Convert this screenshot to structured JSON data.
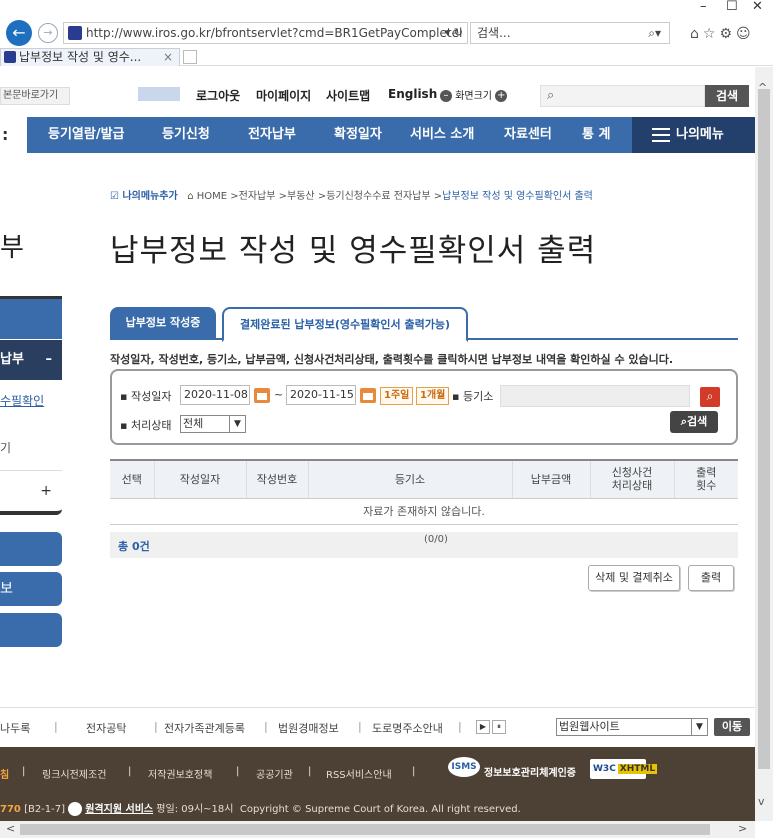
{
  "browser": {
    "address_url": "http://www.iros.go.kr/bfrontservlet?cmd=BR1GetPayCompletel",
    "address_controls": "▾ ↻",
    "search_placeholder": "검색...",
    "tab_title": "납부정보 작성 및 영수...",
    "tab_close": "×",
    "win_min": "–",
    "win_max": "☐",
    "win_close": "✕"
  },
  "util": {
    "skip_link": "본문바로가기",
    "links": [
      "로그아웃",
      "마이페이지",
      "사이트맵",
      "English"
    ],
    "zoom_label": "화면크기",
    "zoom_minus": "–",
    "zoom_plus": "+",
    "search_button": "검색"
  },
  "nav": {
    "items": [
      "등기열람/발급",
      "등기신청",
      "전자납부",
      "확정일자",
      "서비스 소개",
      "자료센터",
      "통 계"
    ],
    "my_menu": "나의메뉴"
  },
  "sidebar": {
    "title_fragment": "부",
    "section_fragment": "납부",
    "section_toggle": "–",
    "link_fragment": "수필확인",
    "link2_fragment": "기",
    "plus": "+",
    "btn_fragment": "보"
  },
  "breadcrumb": {
    "add_menu": "나의메뉴추가",
    "home": "HOME",
    "path": [
      "전자납부",
      "부동산",
      "등기신청수수료 전자납부"
    ],
    "current": "납부정보 작성 및 영수필확인서 출력"
  },
  "page_title": "납부정보 작성 및 영수필확인서 출력",
  "tabs": {
    "writing": "납부정보 작성중",
    "completed": "결제완료된 납부정보(영수필확인서 출력가능)"
  },
  "notice": "작성일자, 작성번호, 등기소, 납부금액, 신청사건처리상태, 출력횟수를 클릭하시면 납부정보 내역을 확인하실 수 있습니다.",
  "form": {
    "date_label": "작성일자",
    "date_from": "2020-11-08",
    "date_sep": "~",
    "date_to": "2020-11-15",
    "week_button": "1주일",
    "month_button": "1개월",
    "registry_label": "등기소",
    "status_label": "처리상태",
    "status_value": "전체",
    "search_button": "검색"
  },
  "table": {
    "headers": [
      "선택",
      "작성일자",
      "작성번호",
      "등기소",
      "납부금액",
      "신청사건\n처리상태",
      "출력\n횟수"
    ],
    "empty_message": "자료가 존재하지 않습니다."
  },
  "pager": {
    "total_prefix": "총 ",
    "total_count": "0",
    "total_suffix": "건",
    "pages": "(0/0)"
  },
  "actions": {
    "delete_cancel": "삭제 및 결제취소",
    "print": "출력"
  },
  "footer": {
    "links1": [
      "나두록",
      "전자공탁",
      "전자가족관계등록",
      "법원경매정보",
      "도로명주소안내"
    ],
    "site_select": "법원웹사이트",
    "go_button": "이동",
    "links2_first": "침",
    "links2": [
      "링크시전제조건",
      "저작권보호정책",
      "공공기관",
      "RSS서비스안내"
    ],
    "isms_label": "ISMS",
    "isms_text": "정보보호관리체계인증",
    "w3c_label": "W3C",
    "w3c_badge": "XHTML",
    "phone_fragment": "770",
    "phone_ext": "[B2-1-7]",
    "remote_service": "원격지원 서비스",
    "hours": "평일: 09시~18시",
    "copyright": "Copyright © Supreme Court of Korea. All right reserved."
  }
}
